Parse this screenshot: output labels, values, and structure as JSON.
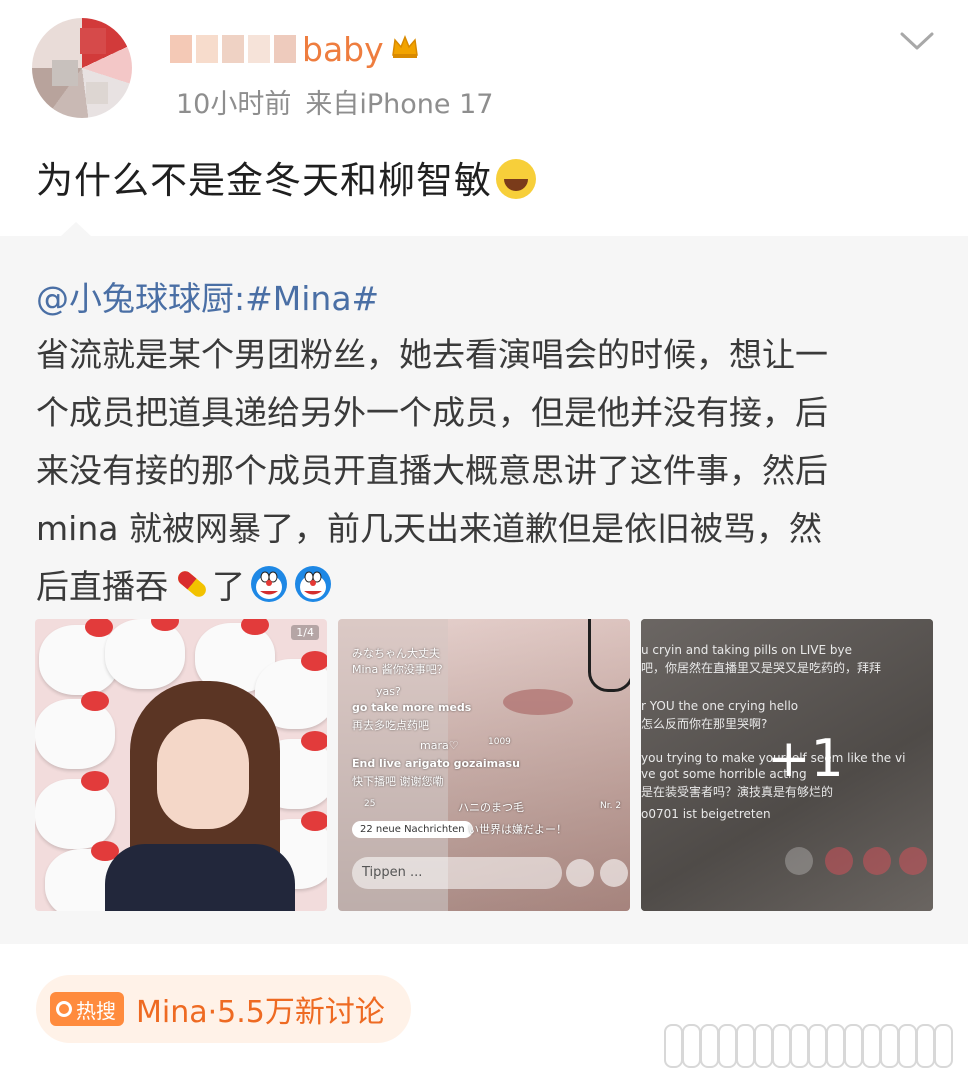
{
  "header": {
    "username": "baby",
    "meta": {
      "time": "10小时前",
      "source": "来自iPhone 17"
    }
  },
  "post": {
    "text": "为什么不是金冬天和柳智敏"
  },
  "repost": {
    "author": "@小兔球球厨:#Mina#",
    "lines": [
      "省流就是某个男团粉丝，她去看演唱会的时候，想让一",
      "个成员把道具递给另外一个成员，但是他并没有接，后",
      "来没有接的那个成员开直播大概意思讲了这件事，然后",
      "mina 就被网暴了，前几天出来道歉但是依旧被骂，然",
      "后直播吞"
    ],
    "tail": "了",
    "images": {
      "count_badge": "1/4",
      "more_label": "+1",
      "live1": {
        "line1": "みなちゃん大丈夫",
        "line2": "Mina 酱你没事吧？",
        "line3": "yas?",
        "line4": "go take more meds",
        "line5": "再去多吃点药吧",
        "line6": "mara♡",
        "line6b": "1009",
        "line7": "End live arigato gozaimasu",
        "line8": "快下播吧 谢谢您嘞",
        "line9": "25",
        "line9b": "ハニのまつ毛",
        "line9c": "Nr. 2",
        "newmsg": "22 neue Nachrichten",
        "line10": "い世界は嫌だよー！",
        "input": "Tippen ..."
      },
      "live2": {
        "line1": "u cryin and taking pills on LIVE bye",
        "line2": "吧，你居然在直播里又是哭又是吃药的，拜拜",
        "line3": "r YOU the one crying hello",
        "line4": "怎么反而你在那里哭啊?",
        "line5": "you trying to make yourself seem like the vi",
        "line6": "ve got some horrible acting",
        "line7": "是在装受害者吗？演技真是有够烂的",
        "line8": "o0701 ist beigetreten"
      }
    }
  },
  "hot_search": {
    "tag": "热搜",
    "text": "Mina·5.5万新讨论"
  },
  "icons": {
    "dropdown": "chevron-down-icon",
    "crown": "crown-icon",
    "laugh": "laughing-crying-emoji-icon",
    "pill": "pill-emoji-icon",
    "doraemon": "doraemon-emoji-icon",
    "search": "search-icon"
  },
  "colors": {
    "username": "#ee7d3f",
    "link": "#4a6fa5",
    "hot_accent": "#ff8b3d"
  }
}
